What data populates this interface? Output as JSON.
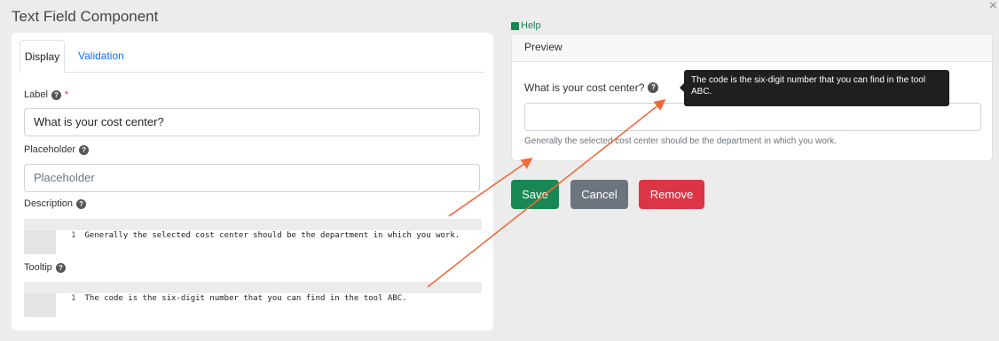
{
  "dialog": {
    "title": "Text Field Component",
    "close": "×"
  },
  "tabs": [
    {
      "label": "Display"
    },
    {
      "label": "Validation"
    }
  ],
  "fields": {
    "label": {
      "title": "Label",
      "required_mark": "*",
      "value": "What is your cost center?"
    },
    "placeholder": {
      "title": "Placeholder",
      "value": "Placeholder"
    },
    "description": {
      "title": "Description",
      "line_number": "1",
      "code": "Generally the selected cost center should be the department in which you work."
    },
    "tooltip": {
      "title": "Tooltip",
      "line_number": "1",
      "code": "The code is the six-digit number that you can find in the tool ABC."
    }
  },
  "help": {
    "label": "Help"
  },
  "preview": {
    "header": "Preview",
    "question": "What is your cost center?",
    "description": "Generally the selected cost center should be the department in which you work.",
    "tooltip_text": "The code is the six-digit number that you can find in the tool ABC."
  },
  "buttons": {
    "save": "Save",
    "cancel": "Cancel",
    "remove": "Remove"
  },
  "colors": {
    "annotation_arrow": "#f06a3a",
    "save": "#198754",
    "cancel": "#6c757d",
    "remove": "#dc3545",
    "link": "#0d6efd"
  }
}
